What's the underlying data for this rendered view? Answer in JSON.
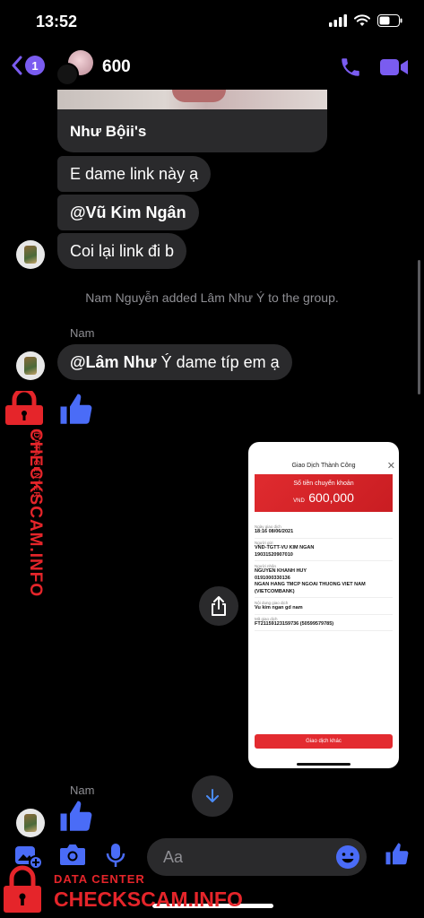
{
  "status_bar": {
    "time": "13:52"
  },
  "header": {
    "back_badge": "1",
    "title": "600"
  },
  "messages": {
    "card_title": "Như Bội",
    "card_title_suffix": "i's",
    "msg1": "E dame link này ạ",
    "msg2": "@Vũ Kim Ngân",
    "msg3": "Coi lại link đi b",
    "system": "Nam Nguyễn added Lâm Như Ý to the group.",
    "sender1": "Nam",
    "msg4_mention": "@Lâm Như",
    "msg4_rest": " Ý dame típ em ạ",
    "sender2": "Nam"
  },
  "receipt": {
    "title": "Giao Dịch Thành Công",
    "banner_label": "Số tiền chuyển khoản",
    "currency": "VND",
    "amount": "600,000",
    "fields": [
      {
        "label": "Ngày giao dịch",
        "value": "18:16 08/06/2021"
      },
      {
        "label": "Người gửi",
        "value": "VND-TGTT-VU KIM NGAN\n19031520907010"
      },
      {
        "label": "Người nhận",
        "value": "NGUYEN KHANH HUY\n0191000330136\nNGAN HANG TMCP NGOAI THUONG VIET NAM\n(VIETCOMBANK)"
      },
      {
        "label": "Nội dung giao dịch",
        "value": "Vu kim ngan gd nam"
      },
      {
        "label": "Mã giao dịch",
        "value": "FT21159123159736 (50599579785)"
      }
    ],
    "button": "Giao dịch khác"
  },
  "composer": {
    "placeholder": "Aa"
  },
  "watermark": {
    "top": "DATA CENTER",
    "main": "CHECKSCAM.INFO"
  },
  "colors": {
    "accent": "#7a5cf0",
    "messenger_blue": "#4a6cf7",
    "watermark_red": "#e5252a",
    "bubble": "#2a2a2c"
  }
}
